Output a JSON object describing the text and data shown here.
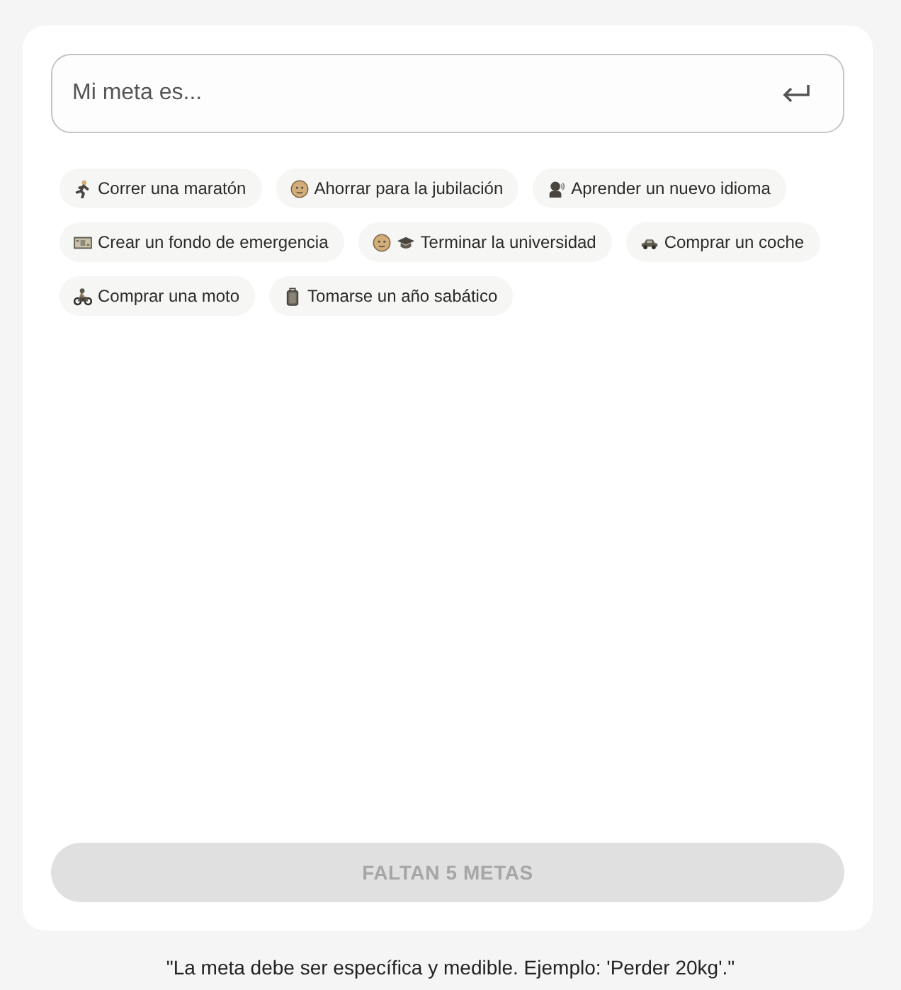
{
  "goal_input": {
    "placeholder": "Mi meta es..."
  },
  "suggestions": [
    {
      "label": "Correr una maratón"
    },
    {
      "label": "Ahorrar para la jubilación"
    },
    {
      "label": "Aprender un nuevo idioma"
    },
    {
      "label": "Crear un fondo de emergencia"
    },
    {
      "label": "Terminar la universidad"
    },
    {
      "label": "Comprar un coche"
    },
    {
      "label": "Comprar una moto"
    },
    {
      "label": "Tomarse un año sabático"
    }
  ],
  "submit_button": {
    "label": "FALTAN 5 METAS",
    "disabled": true
  },
  "hint": "\"La meta debe ser específica y medible. Ejemplo: 'Perder 20kg'.\""
}
